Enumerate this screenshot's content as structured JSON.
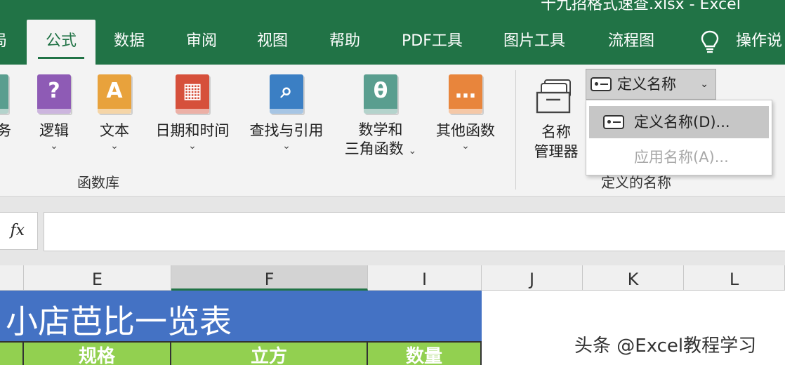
{
  "window": {
    "title": "十九招格式速查.xlsx  -  Excel"
  },
  "tabs": [
    {
      "label": "局",
      "active": false
    },
    {
      "label": "公式",
      "active": true
    },
    {
      "label": "数据",
      "active": false
    },
    {
      "label": "审阅",
      "active": false
    },
    {
      "label": "视图",
      "active": false
    },
    {
      "label": "帮助",
      "active": false
    },
    {
      "label": "PDF工具",
      "active": false
    },
    {
      "label": "图片工具",
      "active": false
    },
    {
      "label": "流程图",
      "active": false
    },
    {
      "label": "操作说",
      "active": false
    }
  ],
  "ribbon": {
    "function_library": {
      "group_label": "函数库",
      "buttons": [
        {
          "label": "务",
          "glyph": "",
          "color": "#5a9e8f",
          "has_chevron": true
        },
        {
          "label": "逻辑",
          "glyph": "?",
          "color": "#8e5bb5",
          "has_chevron": true
        },
        {
          "label": "文本",
          "glyph": "A",
          "color": "#e8a23c",
          "has_chevron": true
        },
        {
          "label": "日期和时间",
          "glyph": "▦",
          "color": "#d6503b",
          "has_chevron": true
        },
        {
          "label": "查找与引用",
          "glyph": "⌕",
          "color": "#3b7fc4",
          "has_chevron": true
        },
        {
          "label": "数学和",
          "label2": "三角函数",
          "glyph": "θ",
          "color": "#5a9e8f",
          "has_chevron": true
        },
        {
          "label": "其他函数",
          "glyph": "…",
          "color": "#e8853c",
          "has_chevron": true
        }
      ]
    },
    "defined_names": {
      "group_label": "定义的名称",
      "name_manager_label1": "名称",
      "name_manager_label2": "管理器",
      "define_name_button": "定义名称",
      "dropdown_items": [
        {
          "label": "定义名称(D)...",
          "enabled": true,
          "highlighted": true
        },
        {
          "label": "应用名称(A)...",
          "enabled": false,
          "highlighted": false
        }
      ]
    }
  },
  "formula_bar": {
    "fx_label": "fx",
    "value": ""
  },
  "columns": [
    "E",
    "F",
    "I",
    "J",
    "K",
    "L"
  ],
  "sheet": {
    "title_cell": "小店芭比一览表",
    "header_row": [
      "规格",
      "立方",
      "数量"
    ]
  },
  "watermark": "头条 @Excel教程学习",
  "colors": {
    "excel_green": "#217346",
    "title_fill": "#4472c4",
    "header_fill": "#92d050"
  }
}
